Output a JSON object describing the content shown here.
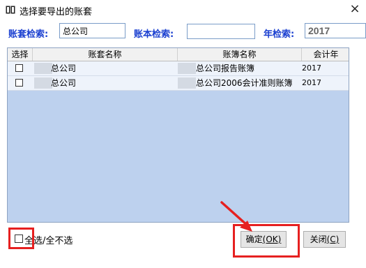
{
  "window": {
    "title": "选择要导出的账套",
    "close": "×"
  },
  "search": {
    "account_set_label": "账套检索:",
    "account_set_value": "总公司",
    "ledger_label": "账本检索:",
    "ledger_value": "",
    "year_label": "年检索:",
    "year_value": "2017"
  },
  "table": {
    "headers": [
      "选择",
      "账套名称",
      "账簿名称",
      "会计年"
    ],
    "rows": [
      {
        "checked": false,
        "account_set": "总公司",
        "ledger": "总公司报告账簿",
        "year": "2017"
      },
      {
        "checked": false,
        "account_set": "总公司",
        "ledger": "总公司2006会计准则账簿",
        "year": "2017"
      }
    ]
  },
  "footer": {
    "select_all_label": "全选/全不选",
    "ok_label": "确定",
    "ok_key": "(OK)",
    "close_label": "关闭",
    "close_key": "(C)"
  },
  "colors": {
    "highlight": "#e62020",
    "search_label": "#1a3fd0",
    "grid_bg": "#bdd1ee"
  }
}
